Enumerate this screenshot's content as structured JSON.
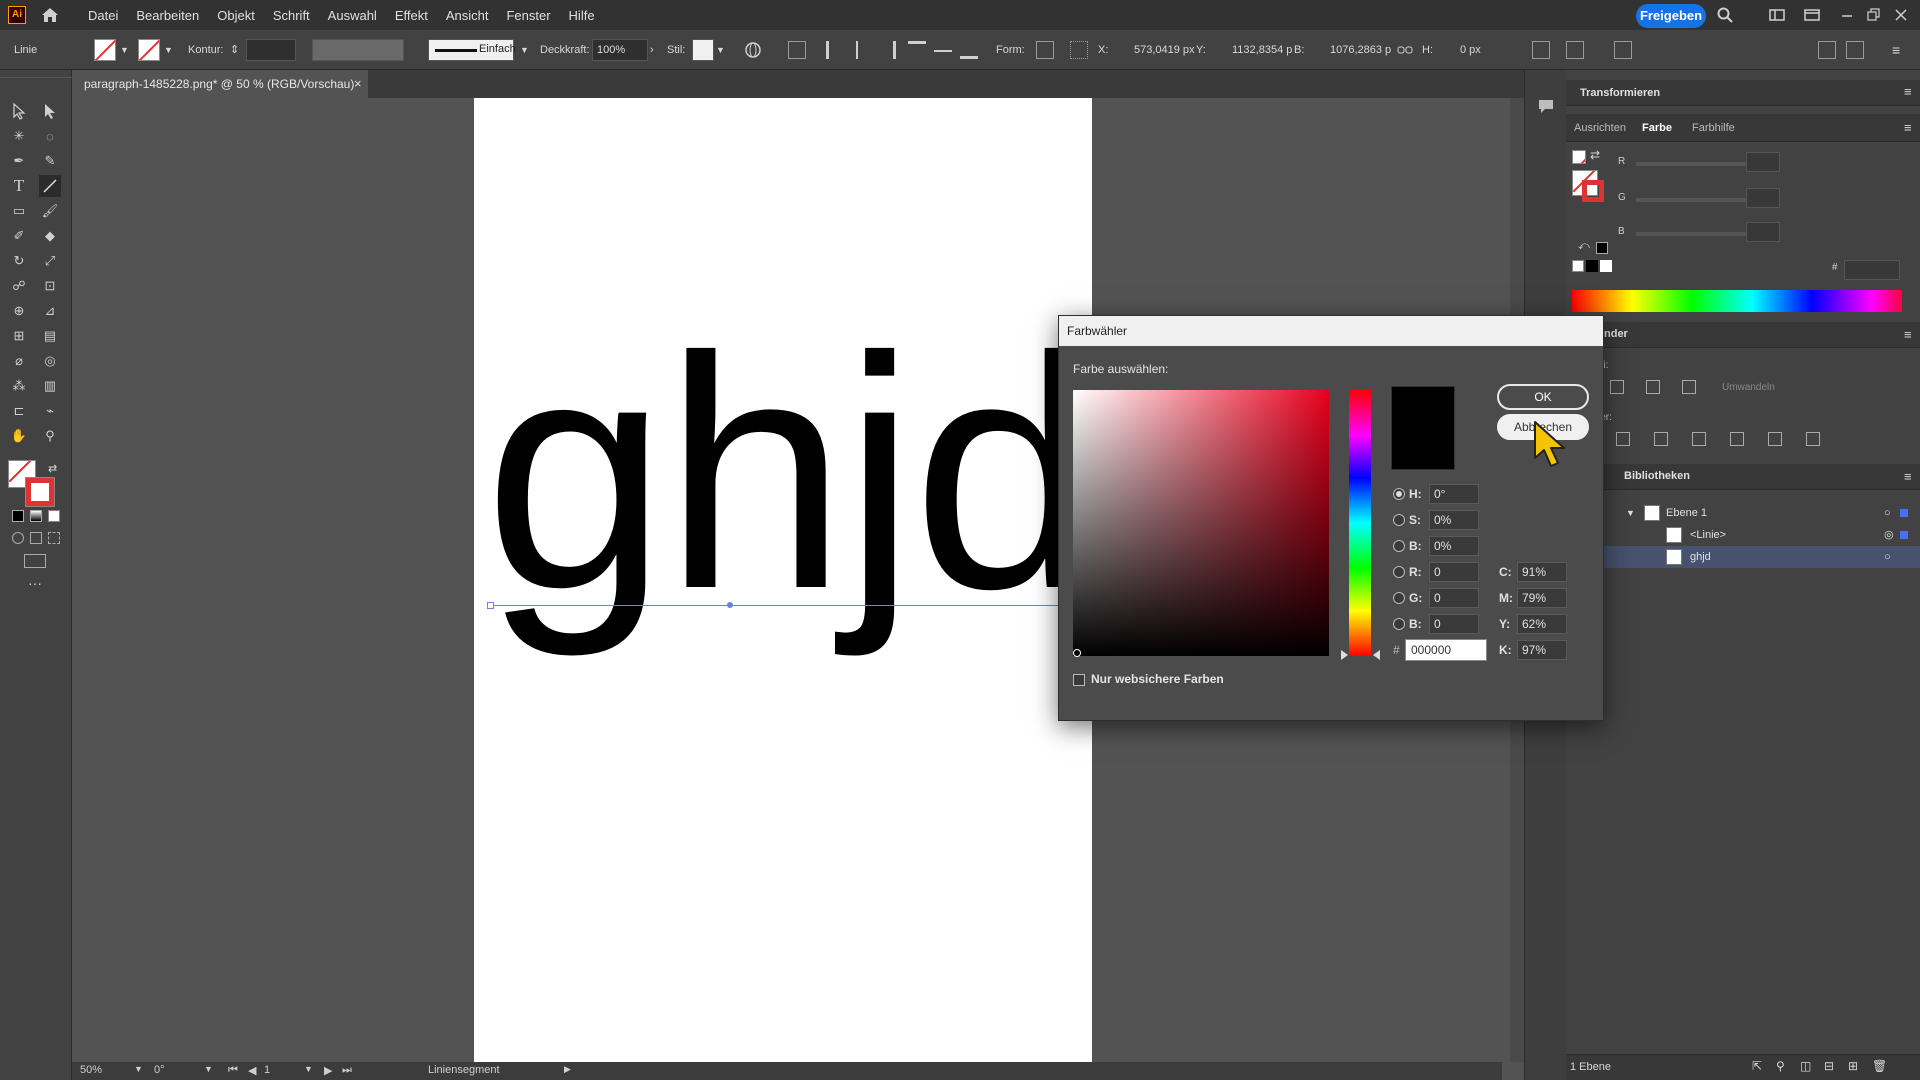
{
  "app": {
    "logo": "Ai",
    "share_label": "Freigeben"
  },
  "menu": [
    "Datei",
    "Bearbeiten",
    "Objekt",
    "Schrift",
    "Auswahl",
    "Effekt",
    "Ansicht",
    "Fenster",
    "Hilfe"
  ],
  "control_bar": {
    "object_type": "Linie",
    "stroke_label": "Kontur:",
    "stroke_style": "Einfach",
    "opacity_label": "Deckkraft:",
    "opacity_value": "100%",
    "style_label": "Stil:",
    "shape_label": "Form:",
    "x_label": "X:",
    "x_value": "573,0419 px",
    "y_label": "Y:",
    "y_value": "1132,8354 p",
    "w_label": "B:",
    "w_value": "1076,2863 p",
    "h_label": "H:",
    "h_value": "0 px"
  },
  "document": {
    "tab_title": "paragraph-1485228.png* @ 50 % (RGB/Vorschau)",
    "tab_close": "×",
    "artwork_text": "ghjd"
  },
  "status_bar": {
    "zoom": "50%",
    "rotation": "0°",
    "artboard": "1",
    "info": "Liniensegment"
  },
  "panels": {
    "transform_title": "Transformieren",
    "tabs": [
      "Ausrichten",
      "Farbe",
      "Farbhilfe"
    ],
    "active_tab": "Farbe",
    "rgb_labels": [
      "R",
      "G",
      "B"
    ],
    "hex_prefix": "#",
    "libraries_title": "Bibliotheken",
    "pathfinder_title_fragment": "nder",
    "partial_label_1": "di:",
    "partial_label_2": "ler:",
    "apply_label": "Umwandeln",
    "layers": [
      {
        "name": "Ebene 1",
        "expanded": true
      },
      {
        "name": "<Linie>"
      },
      {
        "name": "ghjd",
        "selected": true
      }
    ],
    "layer_count": "1 Ebene"
  },
  "color_picker": {
    "title": "Farbwähler",
    "select_label": "Farbe auswählen:",
    "ok_label": "OK",
    "cancel_label": "Abbrechen",
    "hsb": [
      {
        "label": "H:",
        "value": "0°",
        "selected": true
      },
      {
        "label": "S:",
        "value": "0%"
      },
      {
        "label": "B:",
        "value": "0%"
      }
    ],
    "rgb": [
      {
        "label": "R:",
        "value": "0"
      },
      {
        "label": "G:",
        "value": "0"
      },
      {
        "label": "B:",
        "value": "0"
      }
    ],
    "cmyk": [
      {
        "label": "C:",
        "value": "91%"
      },
      {
        "label": "M:",
        "value": "79%"
      },
      {
        "label": "Y:",
        "value": "62%"
      },
      {
        "label": "K:",
        "value": "97%"
      }
    ],
    "hex_prefix": "#",
    "hex": "000000",
    "web_safe_label": "Nur websichere Farben",
    "web_safe_checked": false,
    "current_color": "#000000"
  },
  "colors": {
    "accent": "#1473e6",
    "selection": "#6a7ff0",
    "chrome": "#323232",
    "panel": "#424242"
  }
}
